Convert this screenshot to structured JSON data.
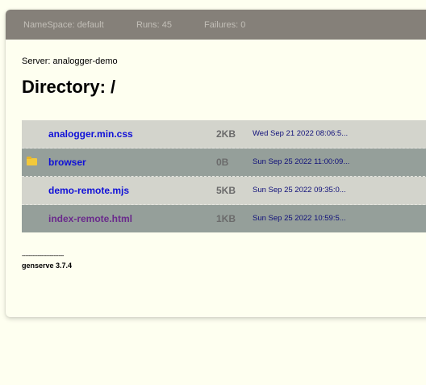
{
  "topbar": {
    "namespace": "NameSpace: default",
    "runs": "Runs: 45",
    "failures": "Failures: 0"
  },
  "server": "Server: analogger-demo",
  "directory_title": "Directory: /",
  "files": [
    {
      "name": "analogger.min.css",
      "size": "2KB",
      "date": "Wed Sep 21 2022 08:06:5...",
      "folder": false
    },
    {
      "name": "browser",
      "size": "0B",
      "date": "Sun Sep 25 2022 11:00:09...",
      "folder": true
    },
    {
      "name": "demo-remote.mjs",
      "size": "5KB",
      "date": "Sun Sep 25 2022 09:35:0...",
      "folder": false
    },
    {
      "name": "index-remote.html",
      "size": "1KB",
      "date": "Sun Sep 25 2022 10:59:5...",
      "folder": false
    }
  ],
  "footer": {
    "rule": "------------------------",
    "generator": "genserve 3.7.4"
  },
  "colors": {
    "topbar": "#858079",
    "row_light": "#d3d4cc",
    "row_dark": "#959f9a",
    "link": "#1010d8",
    "visited_link": "#6a2a8c",
    "page_bg": "#fefff0"
  },
  "icons": {
    "folder": "folder-icon"
  }
}
